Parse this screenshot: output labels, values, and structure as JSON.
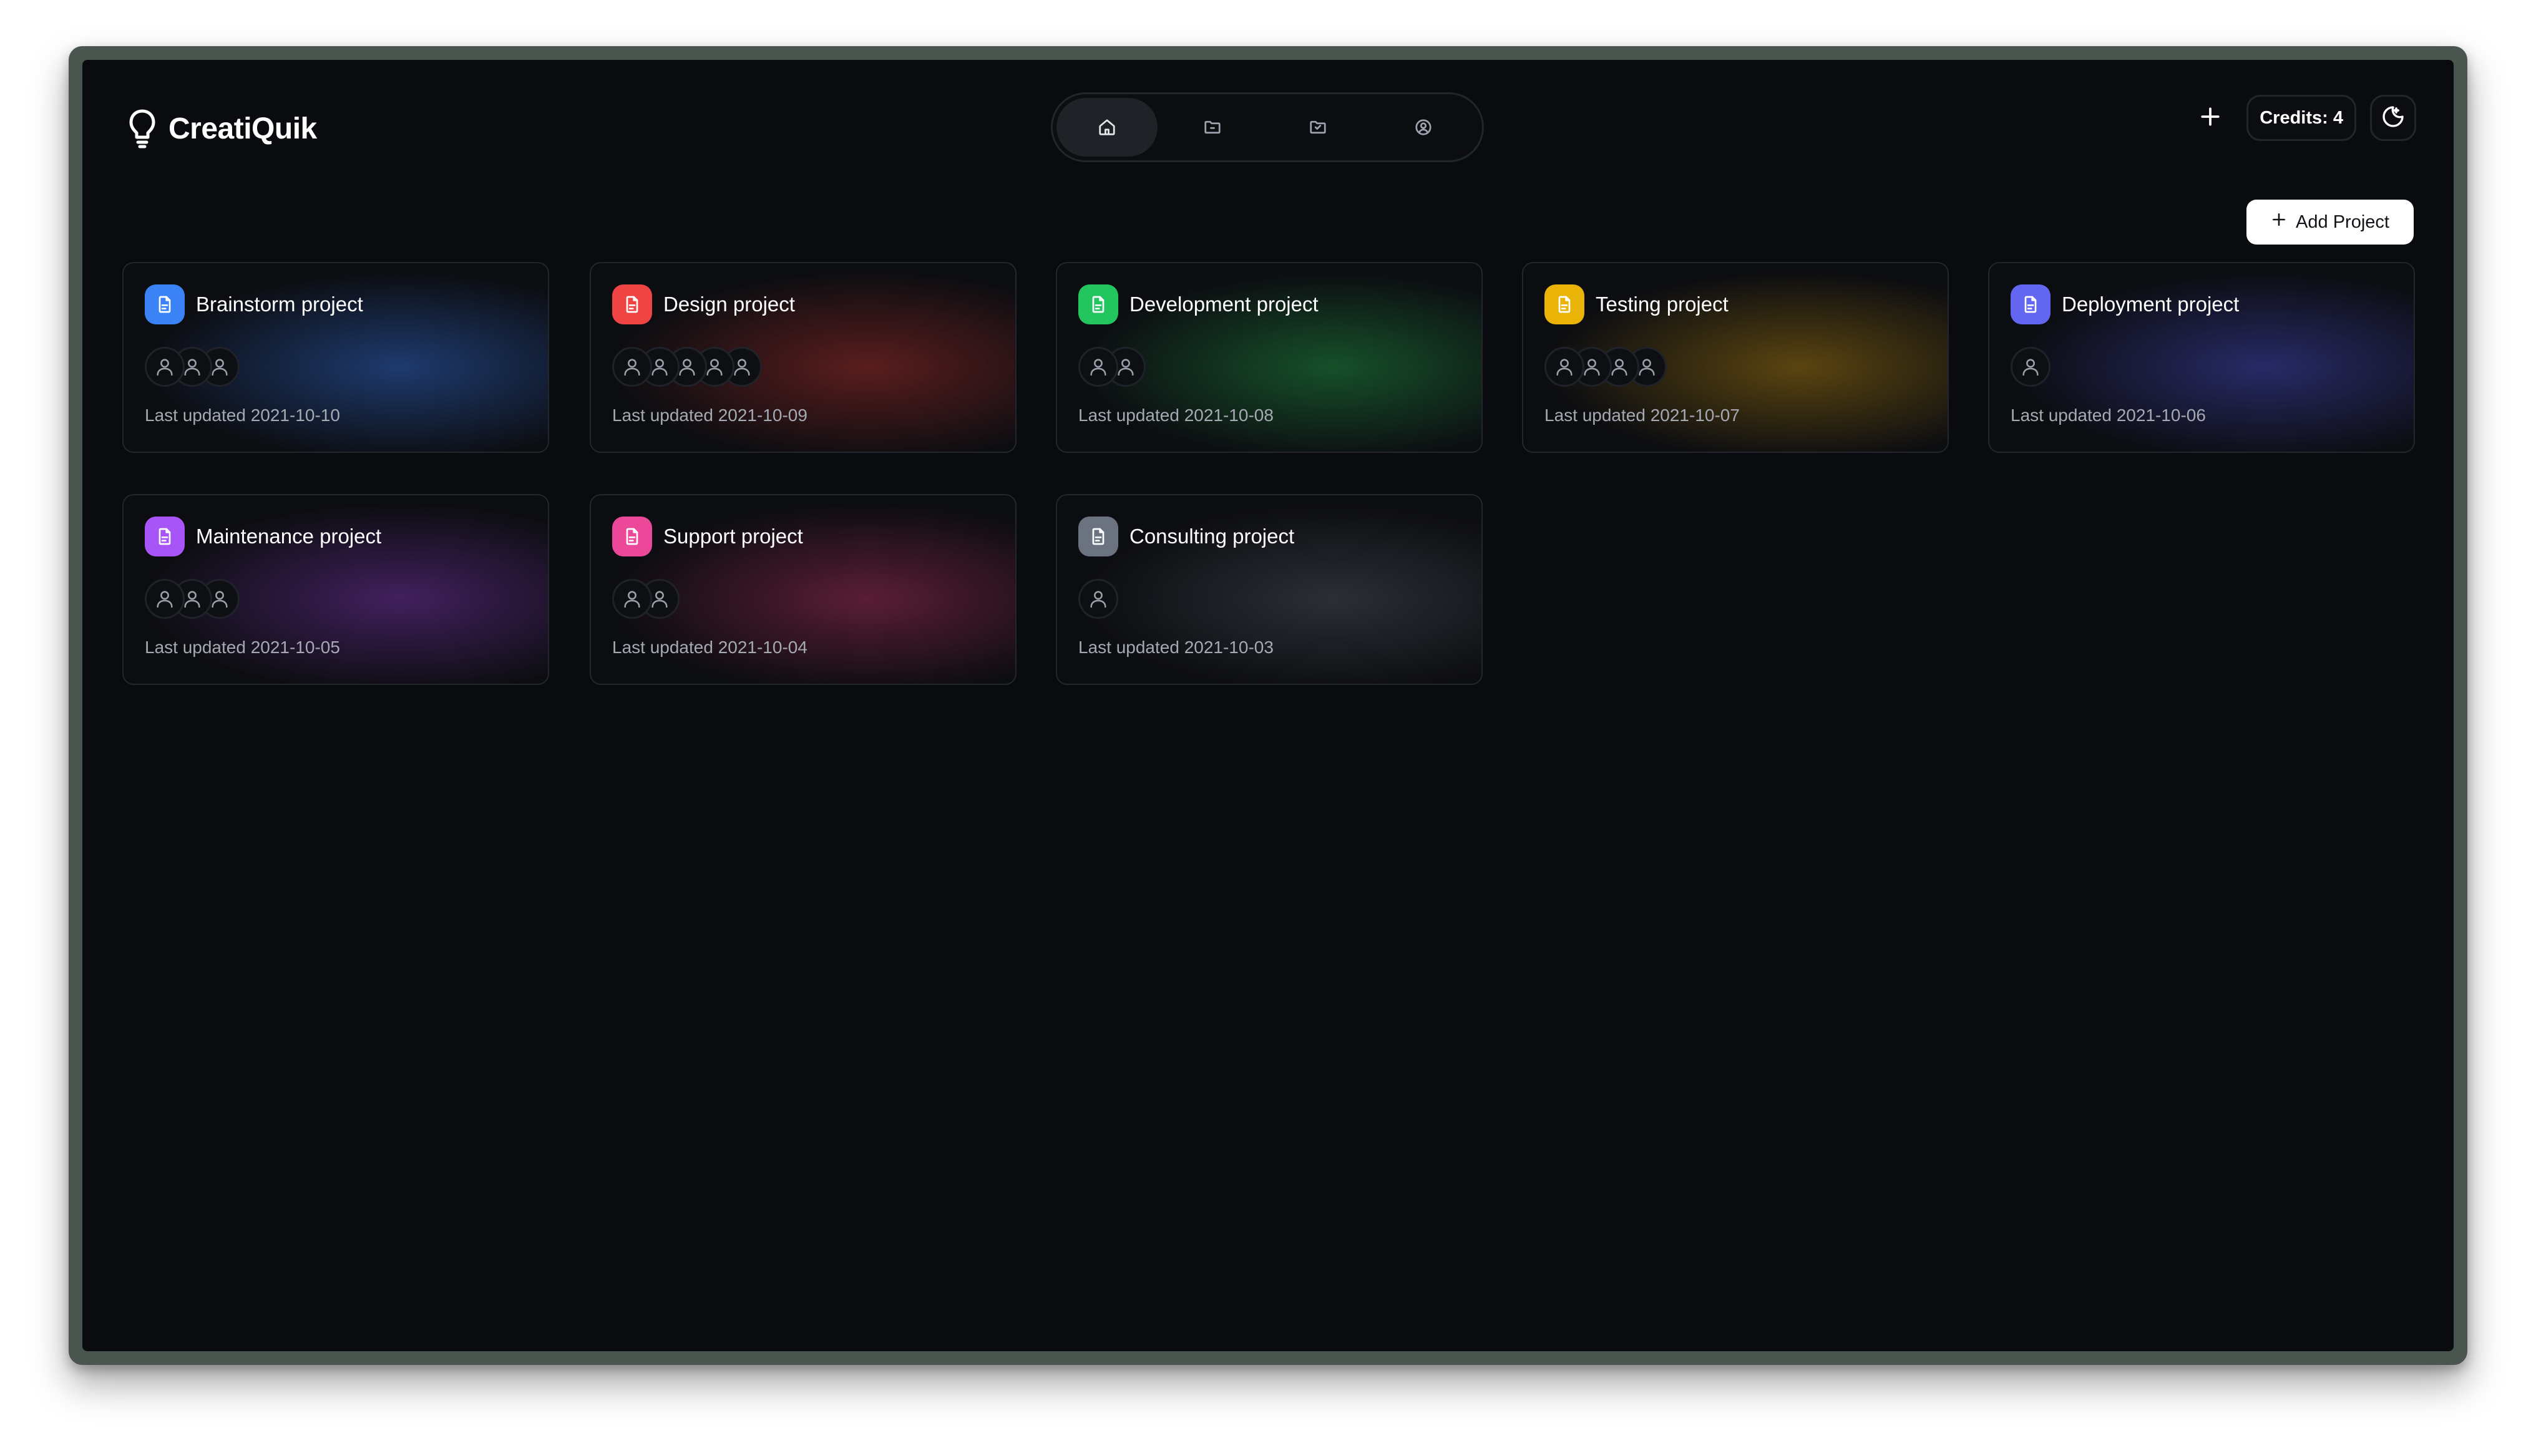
{
  "app": {
    "name": "CreatiQuik"
  },
  "nav": [
    {
      "icon": "home-icon",
      "active": true
    },
    {
      "icon": "folder-icon",
      "active": false
    },
    {
      "icon": "folder-icon",
      "active": false
    },
    {
      "icon": "user-circle-icon",
      "active": false
    }
  ],
  "header": {
    "credits_label": "Credits: 4",
    "plus_icon": "plus-icon",
    "theme_icon": "theme-toggle-icon"
  },
  "actions": {
    "add_project_label": "Add Project"
  },
  "projects": [
    {
      "title": "Brainstorm project",
      "members": 3,
      "updated": "Last updated 2021-10-10",
      "color": "#3b82f6",
      "glow": "#1e3a6e"
    },
    {
      "title": "Design project",
      "members": 5,
      "updated": "Last updated 2021-10-09",
      "color": "#ef4444",
      "glow": "#5a1d1d"
    },
    {
      "title": "Development project",
      "members": 2,
      "updated": "Last updated 2021-10-08",
      "color": "#22c55e",
      "glow": "#16502a"
    },
    {
      "title": "Testing project",
      "members": 4,
      "updated": "Last updated 2021-10-07",
      "color": "#eab308",
      "glow": "#5a4410"
    },
    {
      "title": "Deployment project",
      "members": 1,
      "updated": "Last updated 2021-10-06",
      "color": "#6366f1",
      "glow": "#272a66"
    },
    {
      "title": "Maintenance project",
      "members": 3,
      "updated": "Last updated 2021-10-05",
      "color": "#a855f7",
      "glow": "#42205e"
    },
    {
      "title": "Support project",
      "members": 2,
      "updated": "Last updated 2021-10-04",
      "color": "#ec4899",
      "glow": "#5a1d34"
    },
    {
      "title": "Consulting project",
      "members": 1,
      "updated": "Last updated 2021-10-03",
      "color": "#6b7280",
      "glow": "#2b2e35"
    }
  ]
}
